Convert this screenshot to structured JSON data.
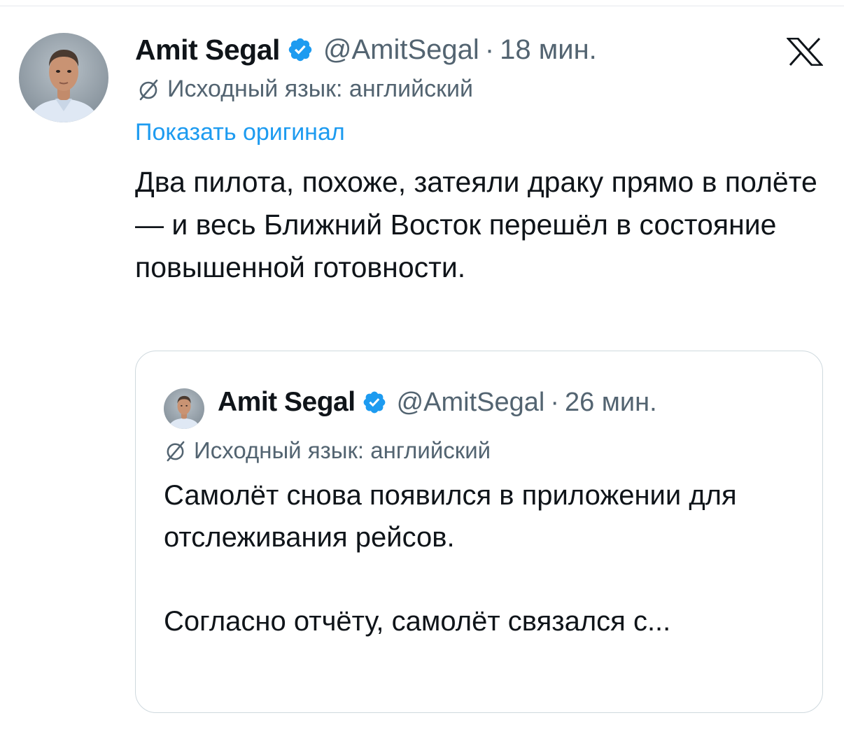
{
  "tweet": {
    "author_name": "Amit Segal",
    "handle": "@AmitSegal",
    "separator": "·",
    "time": "18 мин.",
    "translation_note": "Исходный язык: английский",
    "show_original": "Показать оригинал",
    "text": "Два пилота, похоже, затеяли драку прямо в полёте — и весь Ближний Восток перешёл в состояние повышенной готовности.",
    "icons": {
      "avatar": "avatar-photo",
      "verified": "verified-badge-icon",
      "translate": "translate-icon",
      "brand": "x-logo-icon"
    }
  },
  "quoted": {
    "author_name": "Amit Segal",
    "handle": "@AmitSegal",
    "separator": "·",
    "time": "26 мин.",
    "translation_note": "Исходный язык: английский",
    "paragraph_1": "Самолёт снова появился в приложении для отслеживания рейсов.",
    "paragraph_2": "Согласно отчёту, самолёт связался с..."
  },
  "colors": {
    "text": "#0f1419",
    "secondary": "#536471",
    "link": "#1d9bf0",
    "verified": "#1d9bf0",
    "border": "#cfd9de"
  }
}
